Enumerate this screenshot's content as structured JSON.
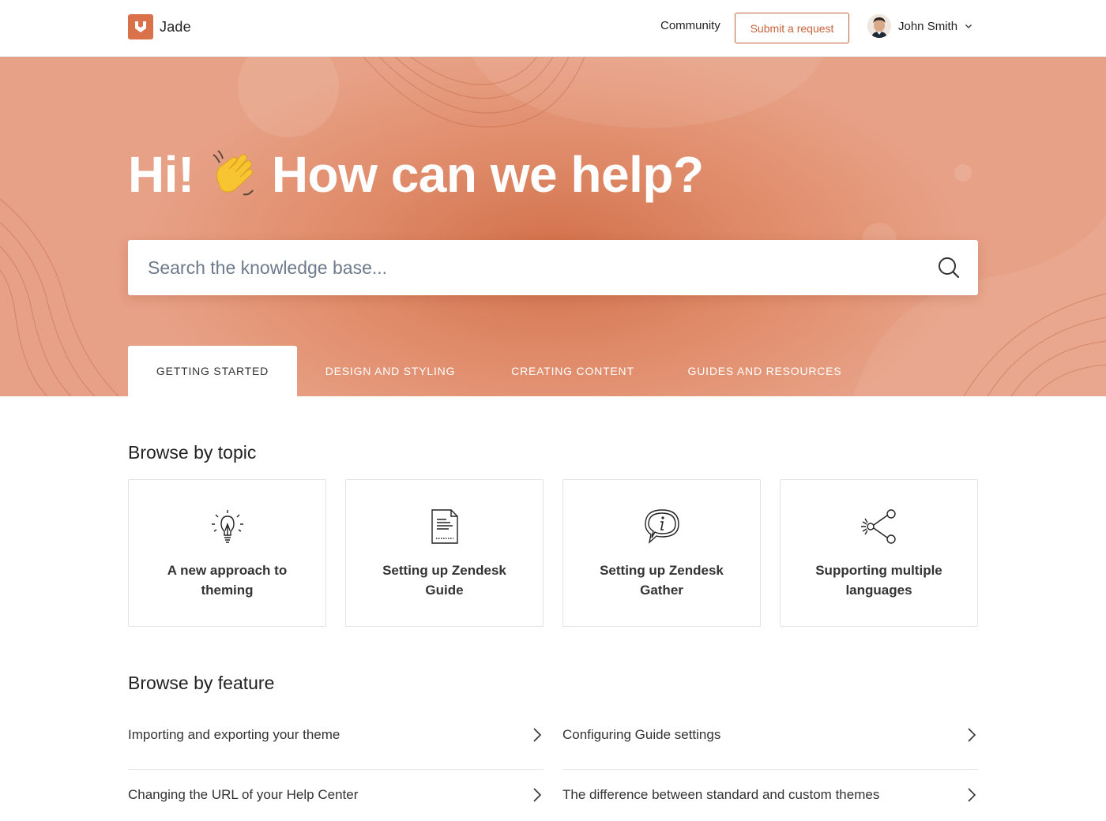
{
  "header": {
    "brand": "Jade",
    "community": "Community",
    "submit_request": "Submit a request",
    "user_name": "John Smith"
  },
  "hero": {
    "greeting_start": "Hi!",
    "greeting_end": "How can we help?",
    "search_placeholder": "Search the knowledge base..."
  },
  "tabs": [
    {
      "label": "GETTING STARTED",
      "active": true
    },
    {
      "label": "DESIGN AND STYLING",
      "active": false
    },
    {
      "label": "CREATING CONTENT",
      "active": false
    },
    {
      "label": "GUIDES AND RESOURCES",
      "active": false
    }
  ],
  "browse_topic": {
    "title": "Browse by topic",
    "cards": [
      {
        "label": "A new approach to theming",
        "icon": "lightbulb-icon"
      },
      {
        "label": "Setting up Zendesk Guide",
        "icon": "document-icon"
      },
      {
        "label": "Setting up Zendesk Gather",
        "icon": "info-bubble-icon"
      },
      {
        "label": "Supporting multiple languages",
        "icon": "share-icon"
      }
    ]
  },
  "browse_feature": {
    "title": "Browse by feature",
    "items": [
      {
        "label": "Importing and exporting your theme"
      },
      {
        "label": "Configuring Guide settings"
      },
      {
        "label": "Changing the URL of your Help Center"
      },
      {
        "label": "The difference between standard and custom themes"
      }
    ]
  },
  "colors": {
    "accent": "#c8623c",
    "hero_center": "#d2704a",
    "hero_edge": "#e7a186"
  }
}
